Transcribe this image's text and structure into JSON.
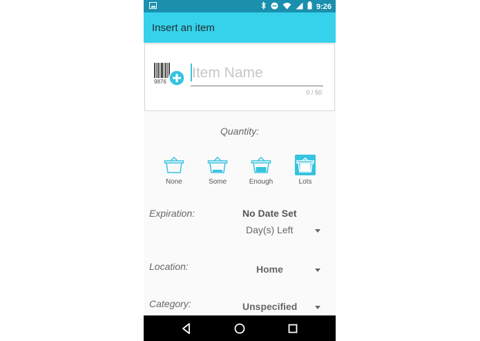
{
  "status_bar": {
    "time": "9:26"
  },
  "app_bar": {
    "title": "Insert an item"
  },
  "item_card": {
    "barcode_number": "9876",
    "name_placeholder": "Item Name",
    "char_count": "0 / 50"
  },
  "quantity": {
    "label": "Quantity:",
    "options": [
      "None",
      "Some",
      "Enough",
      "Lots"
    ],
    "selected": "Lots"
  },
  "expiration": {
    "label": "Expiration:",
    "date": "No Date Set",
    "days_left": "Day(s) Left"
  },
  "location": {
    "label": "Location:",
    "value": "Home"
  },
  "category": {
    "label": "Category:",
    "value": "Unspecified"
  },
  "colors": {
    "app_bar": "#36d1ea",
    "status_bar": "#1a8fae",
    "accent": "#36c3e0"
  },
  "icons": {
    "status": [
      "image-icon",
      "bluetooth-icon",
      "do-not-disturb-icon",
      "wifi-icon",
      "signal-icon",
      "battery-icon"
    ],
    "nav": [
      "back-icon",
      "home-icon",
      "recents-icon"
    ]
  }
}
